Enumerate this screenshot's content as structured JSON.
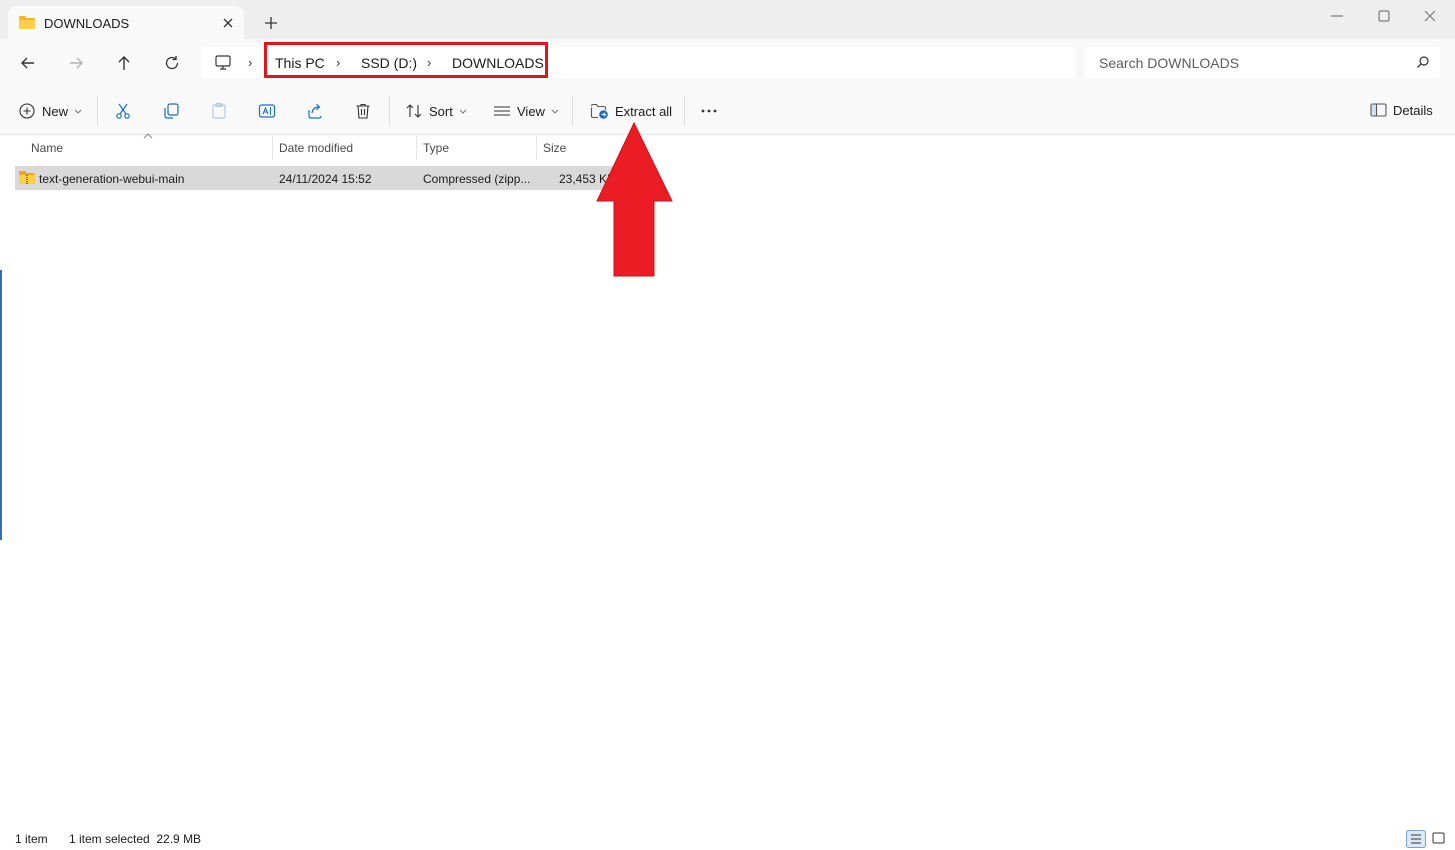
{
  "window": {
    "tab_title": "DOWNLOADS",
    "tab_icon": "folder-icon",
    "new_tab_icon": "plus-icon",
    "controls": [
      "minimize-icon",
      "maximize-icon",
      "close-icon"
    ]
  },
  "nav": {
    "buttons": [
      "back-arrow-icon",
      "forward-arrow-icon",
      "up-arrow-icon",
      "refresh-icon"
    ],
    "address": {
      "root_icon": "this-pc-icon",
      "separator": "›",
      "crumbs": [
        "This PC",
        "SSD (D:)",
        "DOWNLOADS"
      ]
    },
    "search": {
      "placeholder": "Search DOWNLOADS",
      "icon": "search-icon"
    }
  },
  "commandbar": {
    "new_label": "New",
    "sort_label": "Sort",
    "view_label": "View",
    "extract_label": "Extract all",
    "details_label": "Details",
    "icons": [
      "cut-icon",
      "copy-icon",
      "paste-icon",
      "rename-icon",
      "share-icon",
      "delete-icon",
      "more-icon"
    ]
  },
  "filelist": {
    "columns": [
      "Name",
      "Date modified",
      "Type",
      "Size"
    ],
    "rows": [
      {
        "name": "text-generation-webui-main",
        "date": "24/11/2024 15:52",
        "type": "Compressed (zipp...",
        "size": "23,453 KB",
        "icon": "zip-folder-icon",
        "selected": true
      }
    ]
  },
  "status": {
    "count": "1 item",
    "selection": "1 item selected  22.9 MB",
    "views": [
      "details-view-icon",
      "large-icons-view-icon"
    ]
  },
  "annotation": {
    "color": "#e0161e",
    "shapes": [
      "highlight-box",
      "up-arrow"
    ]
  }
}
